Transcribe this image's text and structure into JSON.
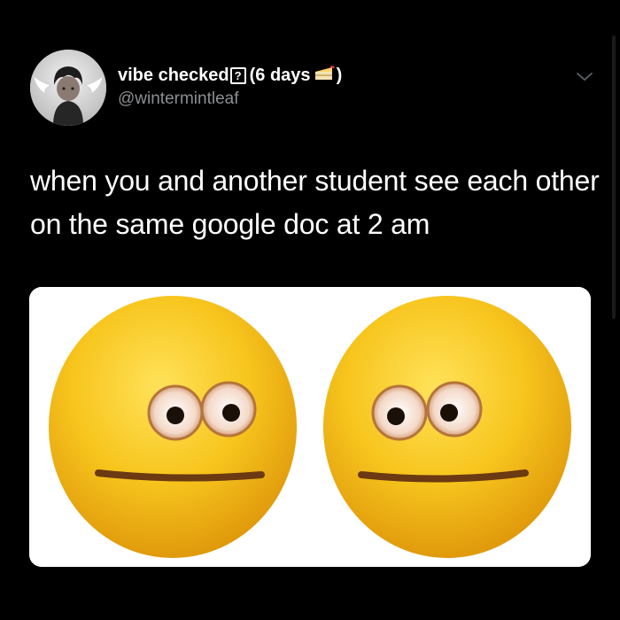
{
  "tweet": {
    "display_name": "vibe checked",
    "badge_symbol": "?",
    "name_suffix_open": "(6 days",
    "name_suffix_close": ")",
    "handle": "@wintermintleaf",
    "text": "when you and another student see each other on the same google doc at 2 am"
  },
  "icons": {
    "badge": "question-box-icon",
    "birthday": "cake-icon",
    "menu": "chevron-down-icon"
  },
  "media": {
    "description": "two-awkward-emoji-faces"
  },
  "colors": {
    "background": "#000000",
    "text": "#ffffff",
    "handle": "#8b8e91",
    "emoji": "#f5c21c"
  }
}
